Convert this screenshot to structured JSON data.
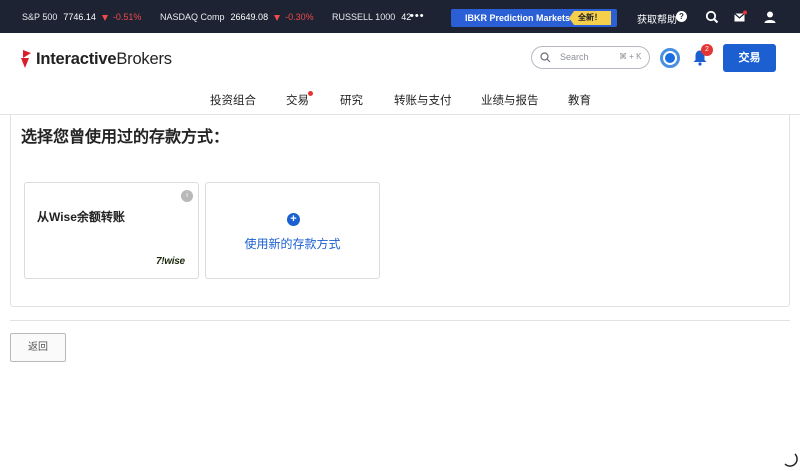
{
  "ticker": {
    "items": [
      {
        "name": "S&P 500",
        "value": "7746.14",
        "change": "-0.51%"
      },
      {
        "name": "NASDAQ Comp",
        "value": "26649.08",
        "change": "-0.30%"
      },
      {
        "name": "RUSSELL 1000",
        "value": "42"
      }
    ],
    "more": "•••",
    "promo_label": "IBKR Prediction Markets",
    "promo_badge": "全新！",
    "help_label": "获取帮助",
    "help_icon": "?"
  },
  "header": {
    "logo_bold": "Interactive",
    "logo_rest": "Brokers",
    "search_placeholder": "Search",
    "search_shortcut": "⌘ + K",
    "notification_count": "2",
    "trade_button": "交易"
  },
  "nav": {
    "items": [
      "投资组合",
      "交易",
      "研究",
      "转账与支付",
      "业绩与报告",
      "教育"
    ]
  },
  "main": {
    "heading": "选择您曾使用过的存款方式：",
    "saved_method": {
      "title": "从Wise余额转账",
      "info": "i",
      "brand": "7!wise"
    },
    "new_method": {
      "plus": "+",
      "label": "使用新的存款方式"
    },
    "back_button": "返回"
  },
  "colors": {
    "ticker_bg": "#1d2332",
    "accent": "#1b5fd1",
    "negative": "#f04a4a",
    "promo_badge": "#f6d04d",
    "alert": "#e53434"
  },
  "icons": [
    "search-icon",
    "chat-icon",
    "mail-icon",
    "user-icon",
    "assistant-icon",
    "bell-icon",
    "info-icon",
    "plus-icon",
    "spinner-icon"
  ]
}
